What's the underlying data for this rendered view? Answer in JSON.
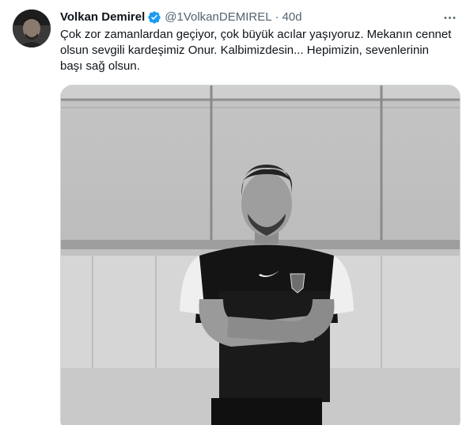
{
  "author": {
    "display_name": "Volkan Demirel",
    "handle": "@1VolkanDEMIREL",
    "separator": "·",
    "time": "40d",
    "verified": true
  },
  "tweet": {
    "text_lines": [
      "Çok zor zamanlardan geçiyor, çok büyük acılar yaşıyoruz. Mekanın cennet",
      "olsun sevgili kardeşimiz Onur. Kalbimizdesin... Hepimizin, sevenlerinin",
      "başı sağ olsun."
    ]
  },
  "icons": {
    "verified": "verified-badge-icon",
    "more": "more-options-icon"
  },
  "colors": {
    "text_primary": "#0f1419",
    "text_secondary": "#536471",
    "verified_blue": "#1d9bf0",
    "border": "#cfd9de"
  }
}
